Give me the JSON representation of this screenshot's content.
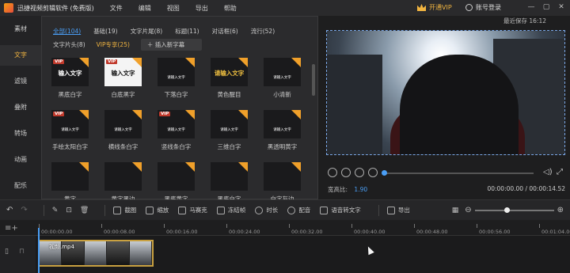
{
  "titlebar": {
    "app_title": "迅捷视频剪辑软件 (免费版)",
    "menu": [
      "文件",
      "编辑",
      "视图",
      "导出",
      "帮助"
    ],
    "vip_label": "开通VIP",
    "account_label": "账号登录",
    "window_controls": [
      "—",
      "▢",
      "✕"
    ]
  },
  "last_saved": "最近保存 16:12",
  "sidebar": {
    "items": [
      {
        "label": "素材"
      },
      {
        "label": "文字",
        "active": true
      },
      {
        "label": "滤镜"
      },
      {
        "label": "叠附"
      },
      {
        "label": "转场"
      },
      {
        "label": "动画"
      },
      {
        "label": "配乐"
      }
    ]
  },
  "library": {
    "tabs_row1": [
      "全部(104)",
      "基础(19)",
      "文字片尾(8)",
      "标题(11)",
      "对话框(6)",
      "流行(52)"
    ],
    "tabs_row2": [
      "文字片头(8)",
      "VIP专享(25)"
    ],
    "insert_button": "插入新字幕",
    "cards": [
      {
        "label": "黑底白字",
        "thumb_text": "输入文字",
        "vip": true,
        "style": "dark-white"
      },
      {
        "label": "白底黑字",
        "thumb_text": "输入文字",
        "vip": true,
        "style": "white-black"
      },
      {
        "label": "下落白字",
        "thumb_text": "请输入文字",
        "vip": false,
        "style": "dark-small"
      },
      {
        "label": "黄色醒目",
        "thumb_text": "请输入文字",
        "vip": false,
        "style": "dark-yellow"
      },
      {
        "label": "小清新",
        "thumb_text": "请输入文字",
        "vip": false,
        "style": "dark-small2"
      },
      {
        "label": "手绘太阳白字",
        "thumb_text": "请输入文字",
        "vip": true,
        "style": "dark-sun"
      },
      {
        "label": "横线条白字",
        "thumb_text": "请输入文字",
        "vip": false,
        "style": "dark-small"
      },
      {
        "label": "竖线条白字",
        "thumb_text": "请输入文字",
        "vip": true,
        "style": "dark-small"
      },
      {
        "label": "三维白字",
        "thumb_text": "请输入文字",
        "vip": false,
        "style": "dark-small"
      },
      {
        "label": "黑透明黄字",
        "thumb_text": "请输入文字",
        "vip": false,
        "style": "dark-small"
      },
      {
        "label": "黄字",
        "thumb_text": "",
        "vip": false,
        "style": "dark"
      },
      {
        "label": "黄字黑边",
        "thumb_text": "",
        "vip": false,
        "style": "dark"
      },
      {
        "label": "黑底黄字",
        "thumb_text": "",
        "vip": false,
        "style": "dark"
      },
      {
        "label": "黑底白字",
        "thumb_text": "",
        "vip": false,
        "style": "dark"
      },
      {
        "label": "白字灰边",
        "thumb_text": "",
        "vip": false,
        "style": "dark"
      }
    ]
  },
  "preview": {
    "aspect_label": "宽高比:",
    "aspect_value": "1.90",
    "timecode": "00:00:00.00 / 00:00:14.52",
    "playback_progress": 0.0
  },
  "toolbar": {
    "tools": [
      "截图",
      "缩放",
      "马赛克",
      "冻结帧",
      "时长",
      "配音",
      "语音转文字",
      "导出"
    ]
  },
  "timeline": {
    "ticks": [
      "00:00:00.00",
      "00:00:08.00",
      "00:00:16.00",
      "00:00:24.00",
      "00:00:32.00",
      "00:00:40.00",
      "00:00:48.00",
      "00:00:56.00",
      "00:01:04.00"
    ],
    "clip_name": "视频.mp4",
    "zoom_level": 0.4
  },
  "colors": {
    "accent": "#4a9ef5",
    "vip": "#f0b440",
    "download_badge": "#f0a02a"
  }
}
